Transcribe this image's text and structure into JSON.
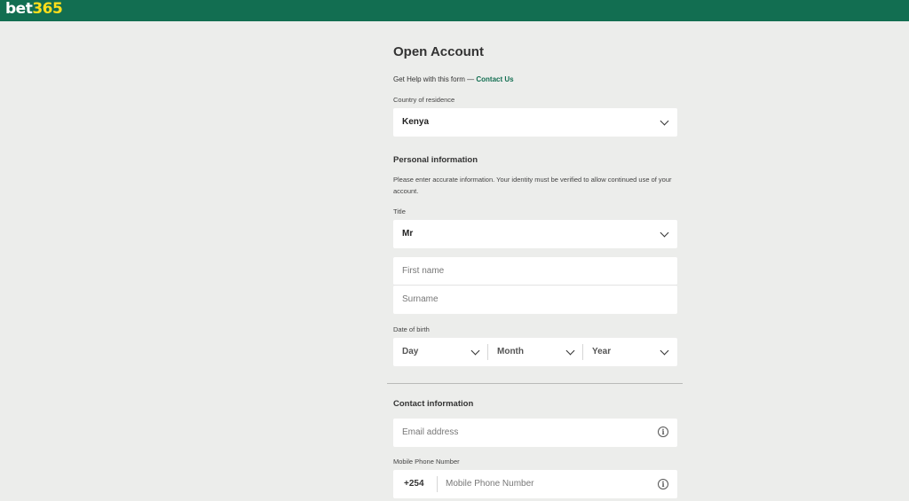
{
  "header": {
    "logo_part1": "bet",
    "logo_part2": "365"
  },
  "form": {
    "title": "Open Account",
    "help_text": "Get Help with this form — ",
    "help_link": "Contact Us",
    "country_label": "Country of residence",
    "country_value": "Kenya",
    "personal": {
      "heading": "Personal information",
      "description": "Please enter accurate information. Your identity must be verified to allow continued use of your account.",
      "title_label": "Title",
      "title_value": "Mr",
      "first_name_placeholder": "First name",
      "surname_placeholder": "Surname",
      "dob_label": "Date of birth",
      "dob_day": "Day",
      "dob_month": "Month",
      "dob_year": "Year"
    },
    "contact": {
      "heading": "Contact information",
      "email_placeholder": "Email address",
      "mobile_label": "Mobile Phone Number",
      "mobile_prefix": "+254",
      "mobile_placeholder": "Mobile Phone Number"
    }
  },
  "colors": {
    "brand_green": "#126e51",
    "brand_yellow": "#ffdf1b",
    "page_bg": "#ecedeb"
  },
  "icons": {
    "select": "chevron-down-icon",
    "info": "info-icon"
  }
}
